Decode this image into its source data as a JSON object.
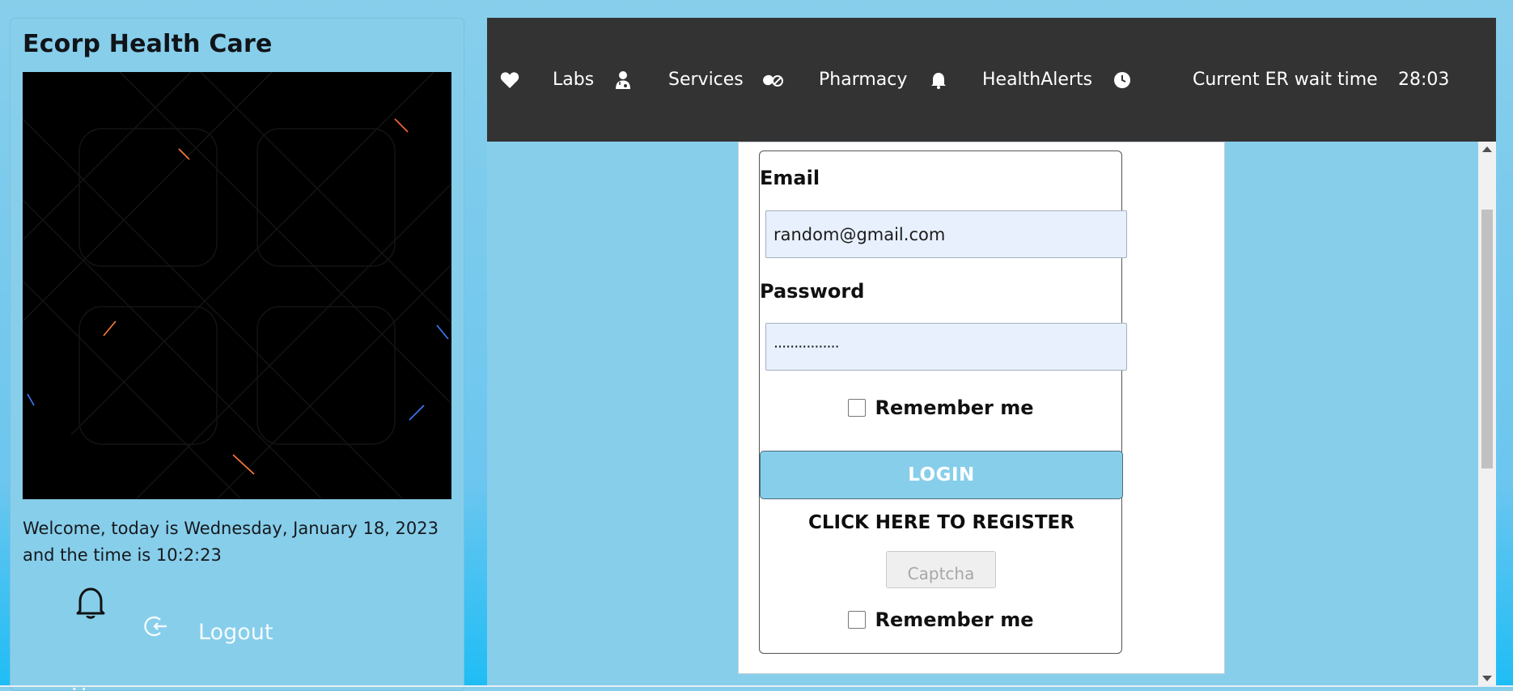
{
  "sidebar": {
    "brand": "Ecorp Health Care",
    "welcome": "Welcome, today is Wednesday, January 18, 2023 and the time is 10:2:23",
    "notification_icon": "bell-icon",
    "logout_icon": "logout-icon",
    "logout_label": "Logout",
    "next_item_label": "H"
  },
  "navbar": {
    "items": [
      {
        "icon": "heart-icon",
        "label": "Labs"
      },
      {
        "icon": "doctor-icon",
        "label": "Services"
      },
      {
        "icon": "pills-icon",
        "label": "Pharmacy"
      },
      {
        "icon": "bell-icon",
        "label": "HealthAlerts"
      },
      {
        "icon": "clock-icon",
        "label": "Current ER wait time"
      }
    ],
    "wait_time": "28:03"
  },
  "login": {
    "email_label": "Email",
    "email_value": "random@gmail.com",
    "password_label": "Password",
    "password_value": "················",
    "remember_label": "Remember me",
    "login_button": "LOGIN",
    "register_link": "CLICK HERE TO REGISTER",
    "captcha_button": "Captcha",
    "remember_label_2": "Remember me"
  },
  "colors": {
    "background": "#87ceeb",
    "navbar": "#333333",
    "login_button": "#87ceeb",
    "input_fill": "#e8f0fe"
  }
}
